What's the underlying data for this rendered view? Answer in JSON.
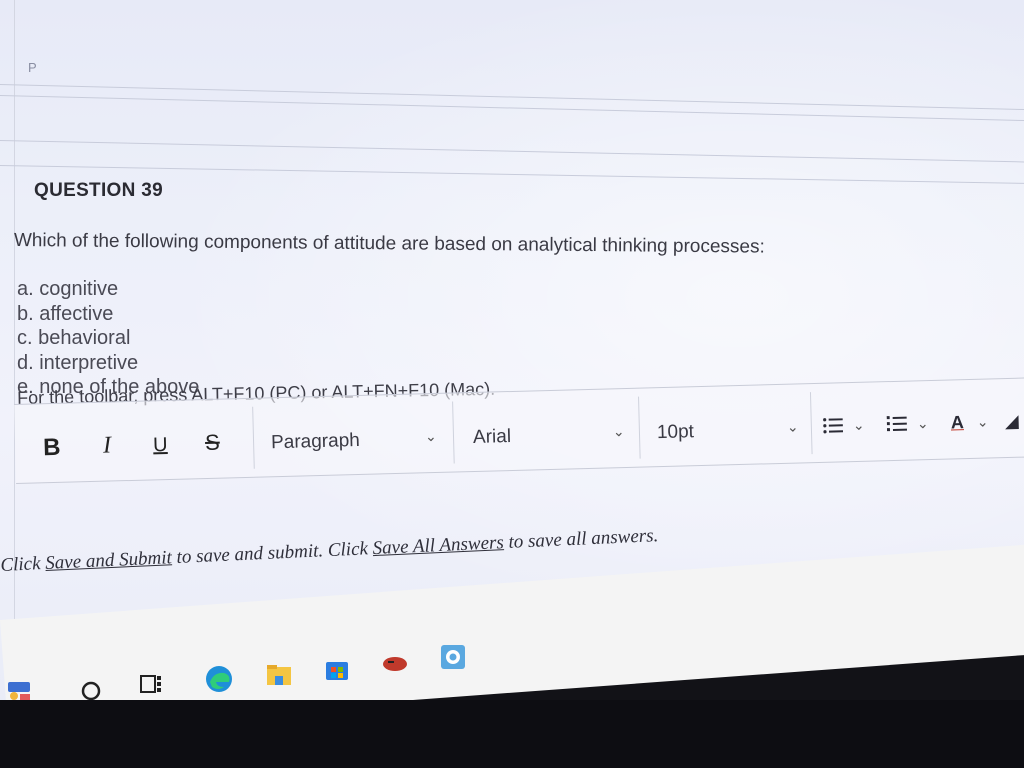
{
  "page": {
    "corner_letter": "P"
  },
  "question": {
    "title": "QUESTION 39",
    "text": "Which of the following components of attitude are based on analytical thinking processes:",
    "options": [
      "a. cognitive",
      "b. affective",
      "c. behavioral",
      "d. interpretive",
      "e. none of the above"
    ]
  },
  "editor": {
    "toolbar_hint": "For the toolbar, press ALT+F10 (PC) or ALT+FN+F10 (Mac).",
    "bold_label": "B",
    "italic_label": "I",
    "underline_label": "U",
    "strike_label": "S",
    "paragraph_label": "Paragraph",
    "font_label": "Arial",
    "size_label": "10pt",
    "font_color_label": "A"
  },
  "footer": {
    "prefix": "Click ",
    "save_submit": "Save and Submit",
    "middle": " to save and submit. Click ",
    "save_all": "Save All Answers",
    "suffix": " to save all answers."
  },
  "taskbar": {
    "icons": [
      "widgets-icon",
      "search-icon",
      "task-view-icon",
      "edge-icon",
      "file-explorer-icon",
      "store-icon",
      "game-icon",
      "app-icon"
    ]
  }
}
